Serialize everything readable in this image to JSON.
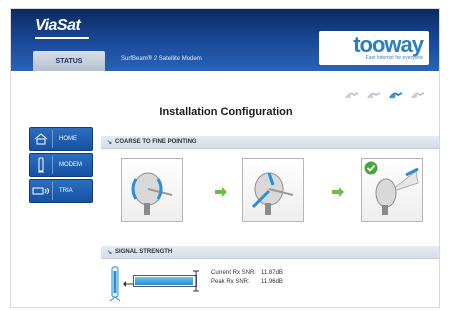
{
  "header": {
    "brand": "ViaSat",
    "device_title": "SurfBeam® 2 Satellite Modem",
    "tabs": [
      {
        "label": "STATUS"
      }
    ],
    "tooway_logo": "tooway",
    "tooway_tagline": "Fast Internet for everyone"
  },
  "progress_steps": [
    {
      "name": "dish-step-1",
      "active": false
    },
    {
      "name": "dish-step-2",
      "active": false
    },
    {
      "name": "dish-step-3",
      "active": true
    },
    {
      "name": "dish-step-4",
      "active": false
    }
  ],
  "page": {
    "title": "Installation Configuration"
  },
  "nav": {
    "items": [
      {
        "label": "HOME",
        "icon": "house-icon"
      },
      {
        "label": "MODEM",
        "icon": "modem-icon"
      },
      {
        "label": "TRIA",
        "icon": "tria-icon"
      }
    ]
  },
  "coarse": {
    "header": "COARSE TO FINE POINTING"
  },
  "signal": {
    "header": "SIGNAL STRENGTH",
    "current_label": "Current Rx SNR:",
    "current_value": "11.87dB",
    "peak_label": "Peak Rx SNR:",
    "peak_value": "11.96dB",
    "level_fraction": 0.97
  },
  "colors": {
    "accent": "#1b4a9a",
    "nav": "#1f5fb1",
    "ok": "#4aa63a",
    "signal": "#2a90cf"
  }
}
